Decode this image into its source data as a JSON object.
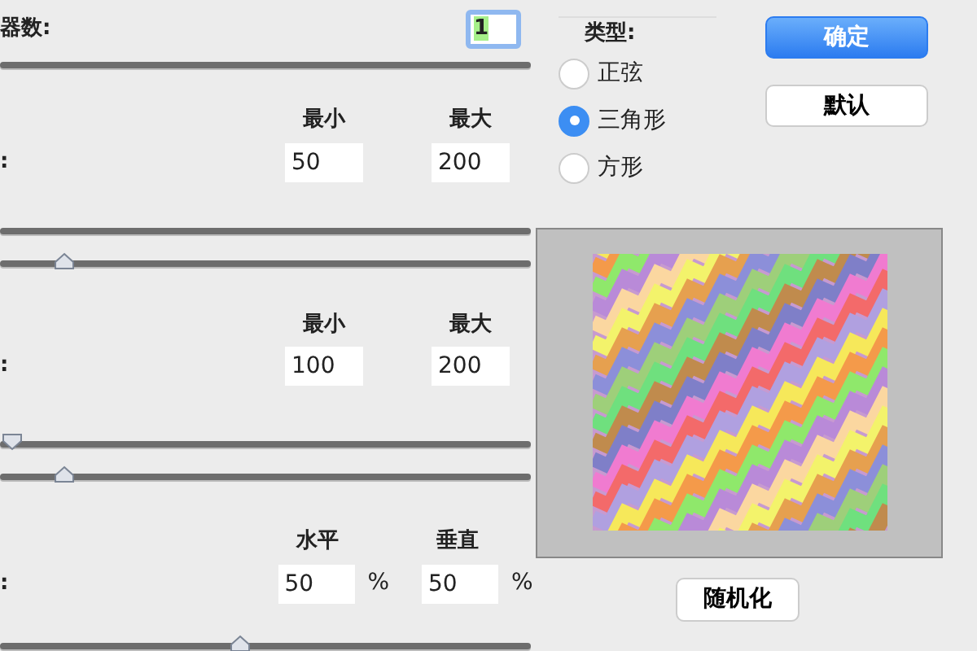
{
  "generators": {
    "label": "器数:",
    "value": "1",
    "focused": true,
    "sliders": [
      {
        "kind": "track"
      }
    ]
  },
  "sections": [
    {
      "label": ":",
      "headers": [
        "最小",
        "最大"
      ],
      "values": [
        "50",
        "200"
      ],
      "sliders": [
        {
          "kind": "track"
        },
        {
          "level": 0.12,
          "kind": "up"
        }
      ]
    },
    {
      "label": ":",
      "headers": [
        "最小",
        "最大"
      ],
      "values": [
        "100",
        "200"
      ],
      "sliders": [
        {
          "level": 0.02,
          "kind": "down"
        },
        {
          "level": 0.12,
          "kind": "up"
        }
      ]
    },
    {
      "label": ":",
      "headers": [
        "水平",
        "垂直"
      ],
      "values": [
        "50",
        "50"
      ],
      "unit": "%",
      "sliders": [
        {
          "level": 0.45,
          "kind": "up"
        }
      ]
    }
  ],
  "type_group": {
    "legend": "类型:",
    "options": [
      {
        "label": "正弦",
        "selected": false
      },
      {
        "label": "三角形",
        "selected": true
      },
      {
        "label": "方形",
        "selected": false
      }
    ]
  },
  "buttons": [
    {
      "label": "确定",
      "kind": "primary"
    },
    {
      "label": "默认",
      "kind": "secondary"
    }
  ],
  "randomize_button": "随机化"
}
